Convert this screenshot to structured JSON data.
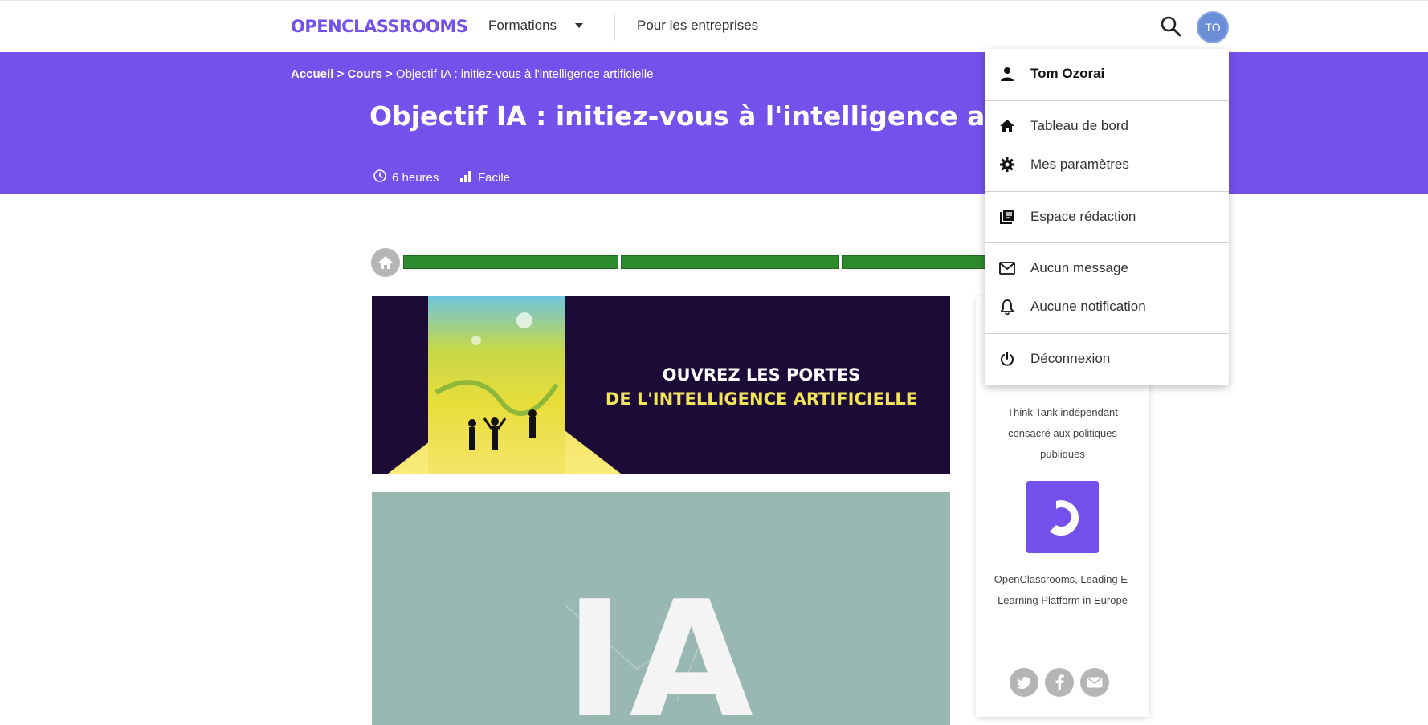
{
  "nav": {
    "logo": "OPENCLASSROOMS",
    "formations": "Formations",
    "entreprises": "Pour les entreprises",
    "avatar_initials": "TO"
  },
  "hero": {
    "breadcrumb": {
      "home": "Accueil",
      "sep1": " > ",
      "courses": "Cours",
      "sep2": " > ",
      "current": "Objectif IA : initiez-vous à l'intelligence artificielle"
    },
    "title": "Objectif IA : initiez-vous à l'intelligence artifici",
    "duration": "6 heures",
    "level": "Facile"
  },
  "banner": {
    "line1": "OUVREZ LES PORTES",
    "line2": "DE L'INTELLIGENCE ARTIFICIELLE"
  },
  "illustration": {
    "text": "IA"
  },
  "sidebar": {
    "partner1": "Think Tank indépendant consacré aux politiques publiques",
    "partner2": "OpenClassrooms, Leading E-Learning Platform in Europe"
  },
  "user_menu": {
    "name": "Tom Ozorai",
    "dashboard": "Tableau de bord",
    "settings": "Mes paramètres",
    "writing": "Espace rédaction",
    "messages": "Aucun message",
    "notifications": "Aucune notification",
    "logout": "Déconnexion"
  },
  "colors": {
    "brand": "#7451eb",
    "progress": "#2d8a2d",
    "avatar": "#6b8dd6"
  }
}
